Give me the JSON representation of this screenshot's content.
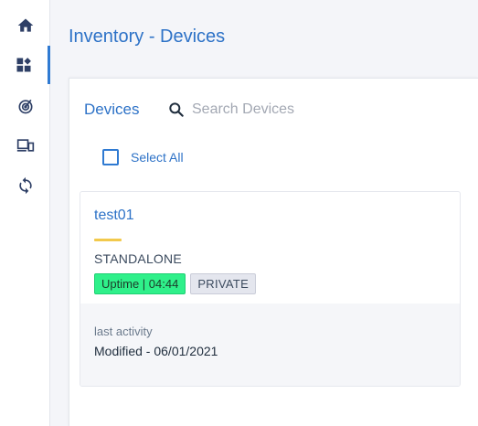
{
  "sidebar": {
    "items": [
      {
        "name": "home",
        "icon": "home-icon"
      },
      {
        "name": "dashboard",
        "icon": "dashboard-icon",
        "active": true
      },
      {
        "name": "monitoring",
        "icon": "radar-icon"
      },
      {
        "name": "devices",
        "icon": "devices-icon"
      },
      {
        "name": "sync",
        "icon": "sync-icon"
      }
    ]
  },
  "header": {
    "title": "Inventory - Devices"
  },
  "panel": {
    "title": "Devices",
    "search": {
      "placeholder": "Search Devices",
      "value": ""
    },
    "select_all_label": "Select All"
  },
  "device_card": {
    "name": "test01",
    "type": "STANDALONE",
    "uptime_badge": "Uptime | 04:44",
    "visibility_badge": "PRIVATE",
    "activity_label": "last activity",
    "activity_value": "Modified - 06/01/2021"
  },
  "colors": {
    "accent": "#2f7ad2",
    "title": "#2d72c7",
    "uptime_green": "#2ff08a",
    "card_accent_yellow": "#f2c94c",
    "icon": "#2e3f66"
  }
}
